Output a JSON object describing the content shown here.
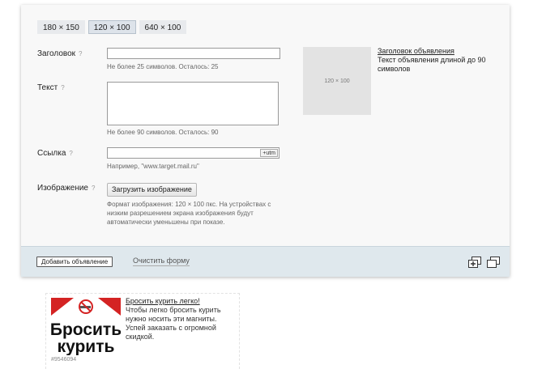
{
  "size_tabs": [
    "180 × 150",
    "120 × 100",
    "640 × 100"
  ],
  "active_size": "120 × 100",
  "form": {
    "title_label": "Заголовок",
    "title_hint": "Не более 25 символов. Осталось: 25",
    "text_label": "Текст",
    "text_hint": "Не более 90 символов. Осталось: 90",
    "link_label": "Ссылка",
    "utm_label": "+utm",
    "link_hint": "Например, \"www.target.mail.ru\"",
    "image_label": "Изображение",
    "upload_label": "Загрузить изображение",
    "image_hint": "Формат изображения: 120 × 100 пкс. На устройствах с низким разрешением экрана изображения будут автоматически уменьшены при показе.",
    "help_mark": "?"
  },
  "preview": {
    "placeholder": "120 × 100",
    "title": "Заголовок объявления",
    "text": "Текст объявления длиной до 90 символов"
  },
  "footer": {
    "add_label": "Добавить объявление",
    "clear_label": "Очистить форму",
    "icons": [
      "add-copy-icon",
      "duplicate-icon"
    ]
  },
  "ad": {
    "image_text_line1": "Бросить",
    "image_text_line2": "курить",
    "title": "Бросить курить легко!",
    "text": "Чтобы легко бросить курить нужно носить эти магниты. Успей заказать с огромной скидкой.",
    "id": "#9546094"
  },
  "colors": {
    "panel_bg": "#f8f8f8",
    "footer_bg": "#dfe8ed",
    "active_tab_border": "#b6c1cc",
    "ad_red": "#d42323"
  }
}
